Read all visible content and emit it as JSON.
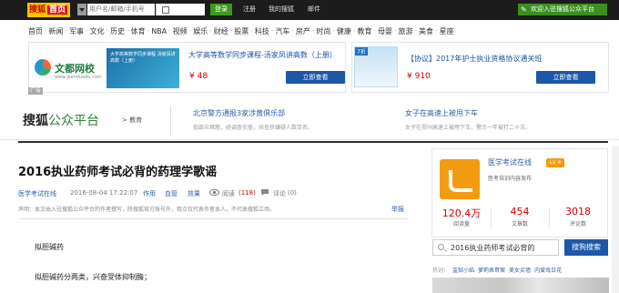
{
  "topbar": {
    "logo": "搜狐",
    "home": "首页",
    "search_placeholder": "用户名/邮箱/手机号",
    "login_button": "登录",
    "links": [
      "注册",
      "我的搜狐",
      "邮件"
    ],
    "welcome": "欢迎入驻搜狐公众平台"
  },
  "nav": [
    "首页",
    "新闻",
    "军事",
    "文化",
    "历史",
    "体育",
    "NBA",
    "视频",
    "娱乐",
    "财经",
    "股票",
    "科技",
    "汽车",
    "房产",
    "时尚",
    "健康",
    "教育",
    "母婴",
    "旅游",
    "美食",
    "星座"
  ],
  "ads": [
    {
      "brand": "文都网校",
      "brand_url": "www.wenduedu.com",
      "book_text": "大学高等数学同步课程 汤家凤讲高数（上册）",
      "title": "大学高等数学同步课程-汤家凤讲高数（上册）",
      "price": "¥ 48",
      "button": "立即查看"
    },
    {
      "tag": "7折",
      "title": "【协议】2017年护士执业资格协议通关班",
      "price": "¥ 910",
      "button": "立即查看"
    }
  ],
  "ad_label": "广告",
  "platform": {
    "name_a": "搜狐",
    "name_b": "公众平台",
    "sub": "> 教育",
    "news": [
      {
        "title": "北京警方通报3家涉黄俱乐部",
        "summary": "捣毁众窝窟，经调查侦查，共查获嫌疑人数百名。"
      },
      {
        "title": "女子在高速上被甩下车",
        "summary": "女子在郑州高速上被甩下车，警示一年被打二十次。"
      }
    ]
  },
  "article": {
    "title": "2016执业药师考试必背的药理学歌谣",
    "source": "医学考试在线",
    "date": "2016-08-04 17:22:07",
    "tags": [
      "作用",
      "血管",
      "效果"
    ],
    "views_label": "阅读",
    "views": "(118)",
    "comments_label": "评论",
    "comments": "(0)",
    "declaration": "声明：本文由入驻搜狐公众平台的作者撰写，除搜狐官方账号外，观点仅代表作者本人，不代表搜狐立场。",
    "report": "举报",
    "p1": "拟胆碱药",
    "p2": "拟胆碱药分两类，兴奋受体抑制酶；"
  },
  "account": {
    "name": "医学考试在线",
    "level": "Lv 4",
    "desc": "医考培训内容发布",
    "stats": [
      {
        "value": "120.4万",
        "label": "阅读量"
      },
      {
        "value": "454",
        "label": "文章数"
      },
      {
        "value": "3018",
        "label": "评论数"
      }
    ]
  },
  "search": {
    "value": "2016执业药师考试必背的",
    "button": "搜狗搜索"
  },
  "hot": {
    "label": "热词：",
    "words": [
      "监狱小焰",
      "萝莉表哥案",
      "美女买墙",
      "内爱戏日花"
    ]
  }
}
